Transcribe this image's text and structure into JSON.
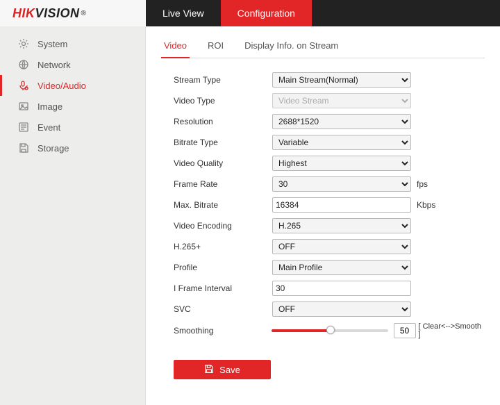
{
  "brand": {
    "part1": "HIK",
    "part2": "VISION",
    "reg": "®"
  },
  "toptabs": {
    "live_view": "Live View",
    "configuration": "Configuration"
  },
  "sidebar": {
    "items": [
      {
        "label": "System"
      },
      {
        "label": "Network"
      },
      {
        "label": "Video/Audio"
      },
      {
        "label": "Image"
      },
      {
        "label": "Event"
      },
      {
        "label": "Storage"
      }
    ]
  },
  "subtabs": {
    "video": "Video",
    "roi": "ROI",
    "display_info": "Display Info. on Stream"
  },
  "form": {
    "stream_type": {
      "label": "Stream Type",
      "value": "Main Stream(Normal)"
    },
    "video_type": {
      "label": "Video Type",
      "value": "Video Stream"
    },
    "resolution": {
      "label": "Resolution",
      "value": "2688*1520"
    },
    "bitrate_type": {
      "label": "Bitrate Type",
      "value": "Variable"
    },
    "video_quality": {
      "label": "Video Quality",
      "value": "Highest"
    },
    "frame_rate": {
      "label": "Frame Rate",
      "value": "30",
      "unit": "fps"
    },
    "max_bitrate": {
      "label": "Max. Bitrate",
      "value": "16384",
      "unit": "Kbps"
    },
    "video_encoding": {
      "label": "Video Encoding",
      "value": "H.265"
    },
    "h265plus": {
      "label": "H.265+",
      "value": "OFF"
    },
    "profile": {
      "label": "Profile",
      "value": "Main Profile"
    },
    "i_frame": {
      "label": "I Frame Interval",
      "value": "30"
    },
    "svc": {
      "label": "SVC",
      "value": "OFF"
    },
    "smoothing": {
      "label": "Smoothing",
      "value": "50",
      "legend": "[ Clear<-->Smooth ]"
    }
  },
  "save_label": "Save"
}
